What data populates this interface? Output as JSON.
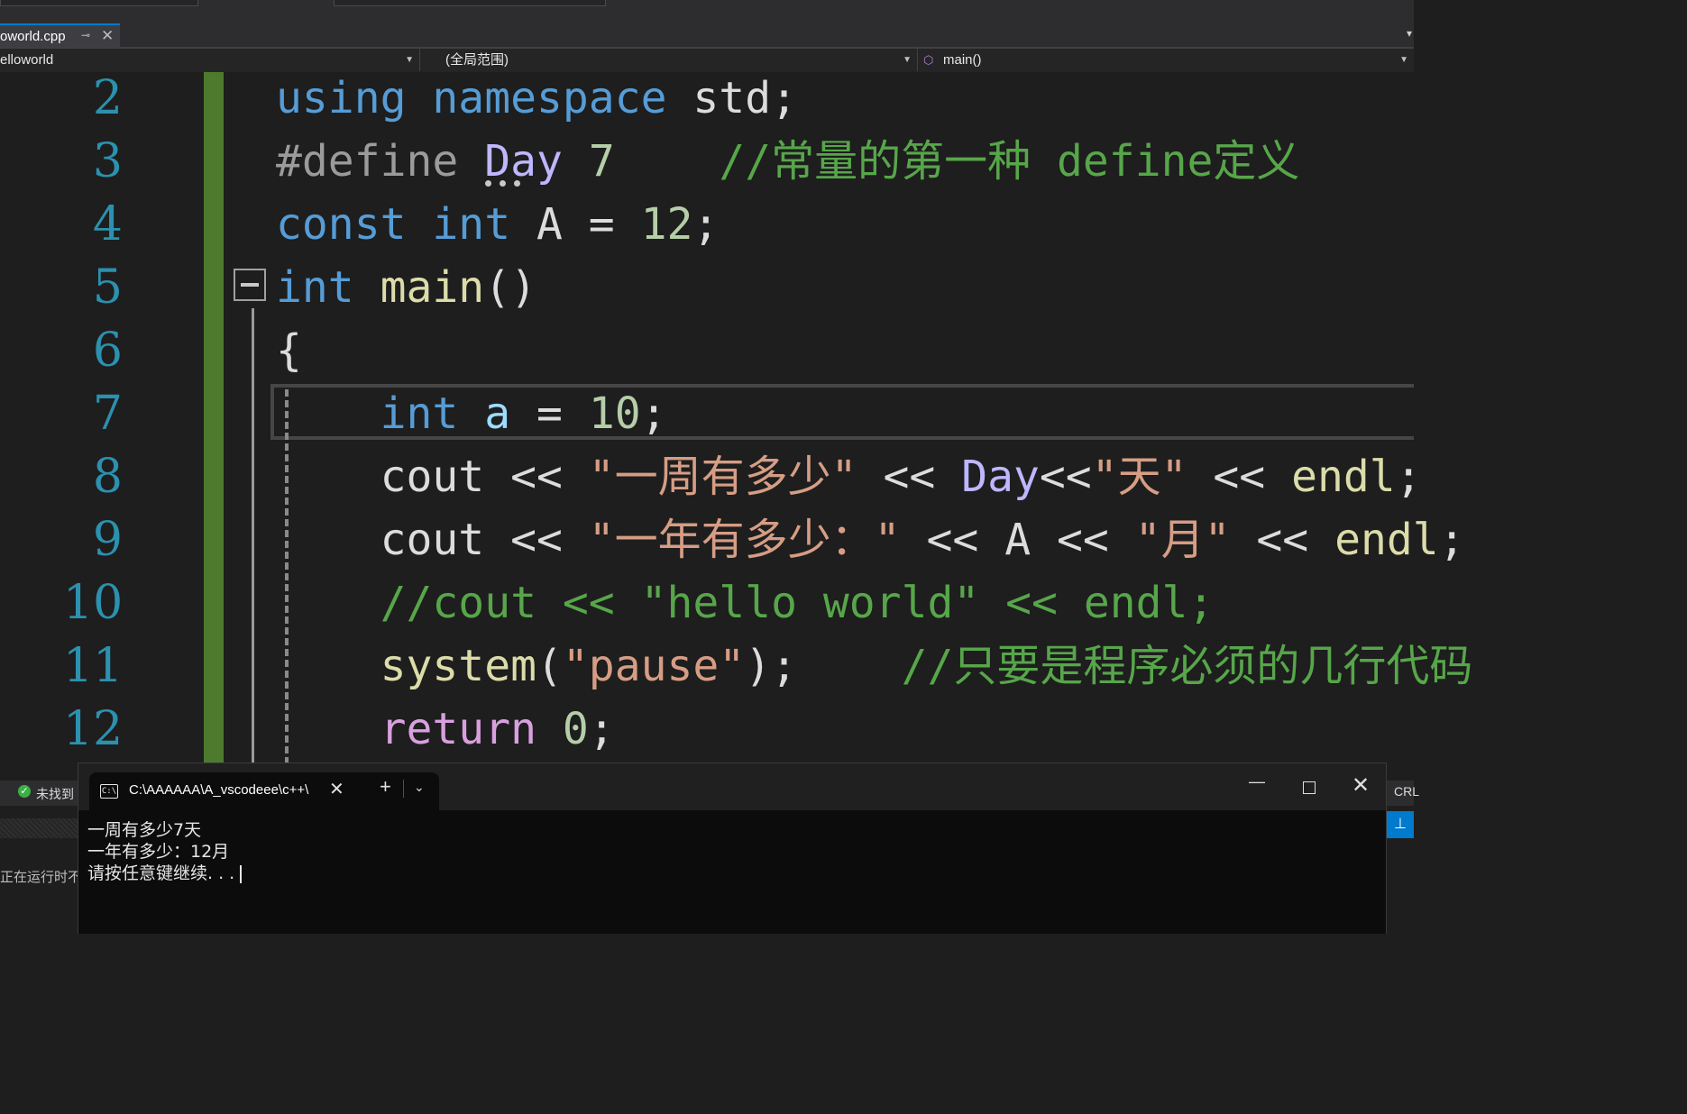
{
  "file_tab": {
    "name": "oworld.cpp",
    "pin_icon": "pin-icon",
    "close_icon": "close-icon"
  },
  "navbar": {
    "project": "elloworld",
    "scope": "(全局范围)",
    "member": "main()"
  },
  "editor": {
    "line_numbers": [
      "2",
      "3",
      "4",
      "5",
      "6",
      "7",
      "8",
      "9",
      "10",
      "11",
      "12"
    ]
  },
  "status": {
    "message": "未找到",
    "line_ending": "CRL",
    "runtime_text": "正在运行时不"
  },
  "console": {
    "tab_title": "C:\\AAAAAA\\A_vscodeee\\c++\\",
    "icon_glyph": "C:\\",
    "output": [
      "一周有多少7天",
      "一年有多少：12月",
      "请按任意键继续. . ."
    ]
  },
  "colors": {
    "keyword": "#569cd6",
    "comment": "#57a64a",
    "string": "#d69d85",
    "number": "#b5cea8",
    "function": "#dcdcaa",
    "macro": "#beb7ff",
    "line_number": "#2b91af",
    "change_bar": "#4d7a2c"
  }
}
